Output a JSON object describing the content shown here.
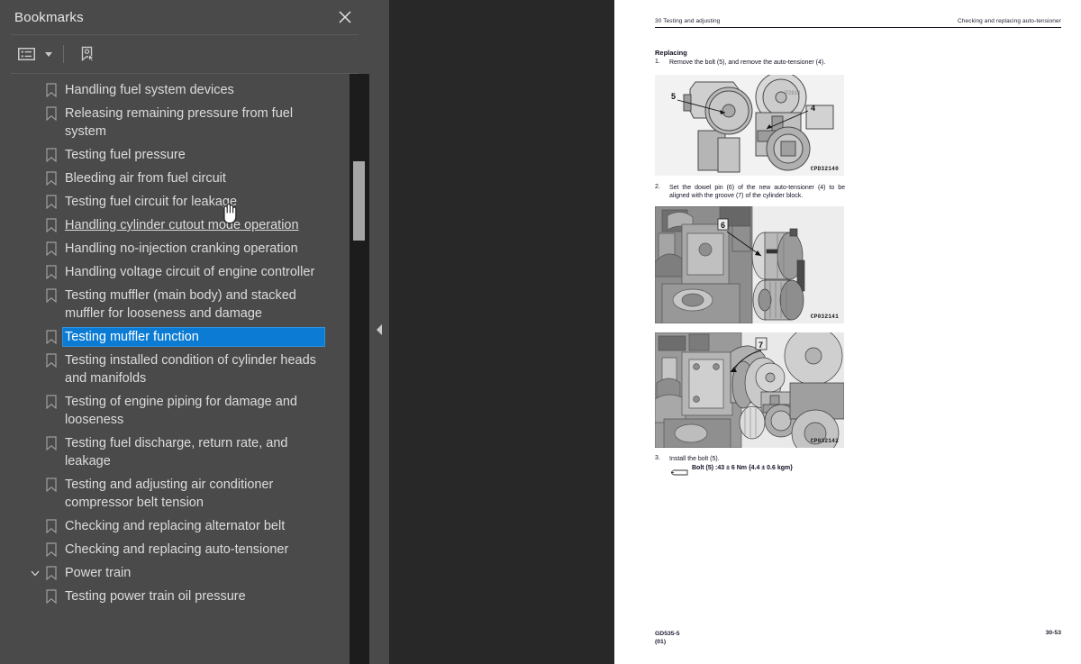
{
  "panel": {
    "title": "Bookmarks",
    "close_icon": "close-icon",
    "toolbar": {
      "list_options_label": "list-options",
      "list_options_icon": "list-view-icon",
      "expand_caret_icon": "chevron-down-icon",
      "new_bookmark_icon": "new-bookmark-icon"
    },
    "items": [
      {
        "label": "Handling fuel system devices",
        "depth": 1,
        "state": "normal"
      },
      {
        "label": "Releasing remaining pressure from fuel system",
        "depth": 1,
        "state": "normal"
      },
      {
        "label": "Testing fuel pressure",
        "depth": 1,
        "state": "normal"
      },
      {
        "label": "Bleeding air from fuel circuit",
        "depth": 1,
        "state": "normal"
      },
      {
        "label": "Testing fuel circuit for leakage",
        "depth": 1,
        "state": "normal"
      },
      {
        "label": "Handling cylinder cutout mode operation",
        "depth": 1,
        "state": "hovered"
      },
      {
        "label": "Handling no-injection cranking operation",
        "depth": 1,
        "state": "normal"
      },
      {
        "label": "Handling voltage circuit of engine controller",
        "depth": 1,
        "state": "normal"
      },
      {
        "label": "Testing muffler (main body) and stacked muffler for looseness and damage",
        "depth": 1,
        "state": "normal"
      },
      {
        "label": "Testing muffler function",
        "depth": 1,
        "state": "selected"
      },
      {
        "label": "Testing installed condition of cylinder heads and manifolds",
        "depth": 1,
        "state": "normal"
      },
      {
        "label": "Testing of engine piping for damage and looseness",
        "depth": 1,
        "state": "normal"
      },
      {
        "label": "Testing fuel discharge, return rate, and leakage",
        "depth": 1,
        "state": "normal"
      },
      {
        "label": "Testing and adjusting air conditioner compressor belt tension",
        "depth": 1,
        "state": "normal"
      },
      {
        "label": "Checking and replacing alternator belt",
        "depth": 1,
        "state": "normal"
      },
      {
        "label": "Checking and replacing auto-tensioner",
        "depth": 1,
        "state": "normal"
      },
      {
        "label": "Power train",
        "depth": 0,
        "state": "normal",
        "expanded": true
      },
      {
        "label": "Testing power train oil pressure",
        "depth": 1,
        "state": "normal"
      }
    ]
  },
  "collapse_strip": {
    "icon": "chevron-left-icon"
  },
  "document": {
    "header_left": "30 Testing and adjusting",
    "header_right": "Checking and replacing auto-tensioner",
    "section_title": "Replacing",
    "steps": [
      {
        "num": "1.",
        "text": "Remove the bolt (5), and remove the auto-tensioner (4)."
      },
      {
        "num": "2.",
        "text": "Set the dowel pin (6) of the new auto-tensioner (4) to be aligned with the groove (7) of the cylinder block."
      },
      {
        "num": "3.",
        "text": "Install the bolt (5)."
      }
    ],
    "torque_spec": "Bolt (5) :43 ± 6 Nm {4.4 ± 0.6 kgm}",
    "figures": [
      {
        "code": "CPD32140",
        "callouts": [
          "5",
          "4",
          "P2814"
        ]
      },
      {
        "code": "CP032141",
        "callouts": [
          "6"
        ]
      },
      {
        "code": "CP032142",
        "callouts": [
          "7"
        ]
      }
    ],
    "footer_left_line1": "GD535-5",
    "footer_left_line2": "(01)",
    "footer_right": "30-53"
  },
  "colors": {
    "panel_bg": "#4a4a4a",
    "viewer_bg": "#282828",
    "selection_blue": "#0b7bd4",
    "scrollbar_track": "#1c1c1c",
    "scrollbar_thumb": "#a6a6a6",
    "page_white": "#ffffff",
    "doc_text": "#101024"
  }
}
